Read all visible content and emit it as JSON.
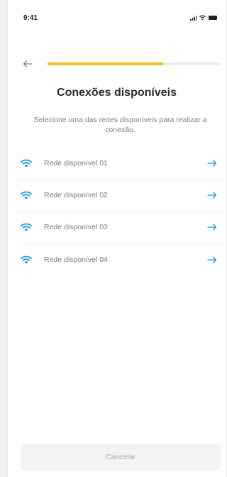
{
  "status_bar": {
    "time": "9:41"
  },
  "header": {
    "progress_percent": 67
  },
  "title": "Conexões disponíveis",
  "subtitle": "Selecione uma das redes disponíveis para realizar a conexão.",
  "networks": [
    {
      "label": "Rede disponível 01",
      "icon": "wifi-icon"
    },
    {
      "label": "Rede disponível 02",
      "icon": "wifi-icon"
    },
    {
      "label": "Rede disponível 03",
      "icon": "wifi-icon"
    },
    {
      "label": "Rede disponível 04",
      "icon": "wifi-icon"
    }
  ],
  "cancel_label": "Cancelar",
  "colors": {
    "accent": "#1a9ad6",
    "progress": "#f7bf1e"
  }
}
